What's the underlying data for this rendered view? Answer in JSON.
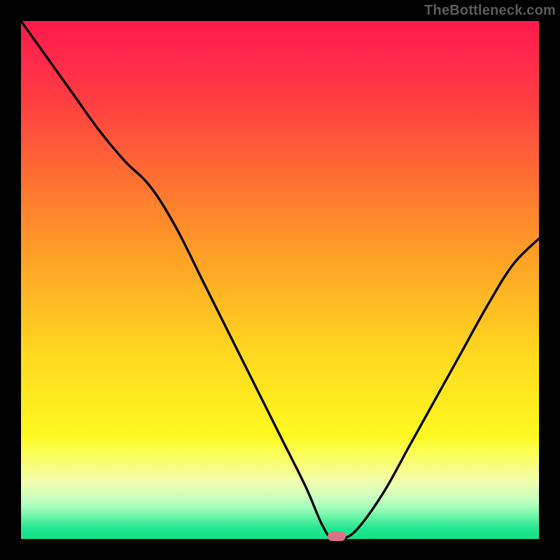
{
  "watermark": "TheBottleneck.com",
  "chart_data": {
    "type": "line",
    "title": "",
    "xlabel": "",
    "ylabel": "",
    "xlim": [
      0,
      100
    ],
    "ylim": [
      0,
      100
    ],
    "x": [
      0,
      5,
      10,
      15,
      20,
      25,
      30,
      35,
      40,
      45,
      50,
      55,
      58,
      60,
      62,
      65,
      70,
      75,
      80,
      85,
      90,
      95,
      100
    ],
    "values": [
      100,
      93,
      86,
      79,
      73,
      68,
      60,
      50,
      40,
      30,
      20,
      10,
      3,
      0,
      0,
      2,
      9,
      18,
      27,
      36,
      45,
      53,
      58
    ],
    "marker": {
      "x": 61,
      "y": 0
    },
    "background_gradient": {
      "stops": [
        {
          "pos": 0,
          "color": "#ff1a4a"
        },
        {
          "pos": 50,
          "color": "#ffc022"
        },
        {
          "pos": 80,
          "color": "#fff820"
        },
        {
          "pos": 92,
          "color": "#c0ffc0"
        },
        {
          "pos": 100,
          "color": "#15e088"
        }
      ]
    }
  }
}
